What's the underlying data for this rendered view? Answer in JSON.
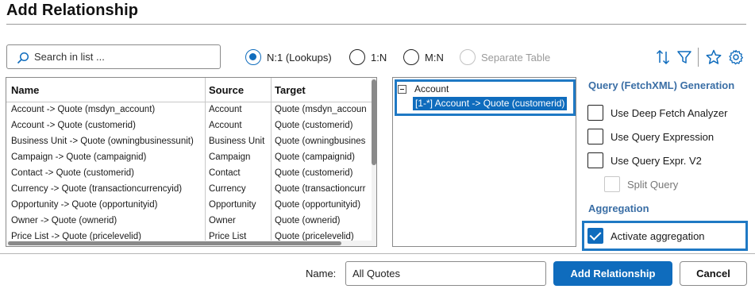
{
  "dialog": {
    "title": "Add Relationship"
  },
  "search": {
    "placeholder": "Search in list ..."
  },
  "radio_options": [
    {
      "label": "N:1 (Lookups)",
      "checked": true
    },
    {
      "label": "1:N",
      "checked": false
    },
    {
      "label": "M:N",
      "checked": false
    },
    {
      "label": "Separate Table",
      "checked": false,
      "disabled": true
    }
  ],
  "toolbar_icons": [
    "sort-icon",
    "filter-icon",
    "star-icon",
    "gear-icon"
  ],
  "table": {
    "columns": [
      "Name",
      "Source",
      "Target"
    ],
    "rows": [
      [
        "Account -> Quote (msdyn_account)",
        "Account",
        "Quote (msdyn_accoun"
      ],
      [
        "Account -> Quote (customerid)",
        "Account",
        "Quote (customerid)"
      ],
      [
        "Business Unit -> Quote (owningbusinessunit)",
        "Business Unit",
        "Quote (owningbusines"
      ],
      [
        "Campaign -> Quote (campaignid)",
        "Campaign",
        "Quote (campaignid)"
      ],
      [
        "Contact -> Quote (customerid)",
        "Contact",
        "Quote (customerid)"
      ],
      [
        "Currency -> Quote (transactioncurrencyid)",
        "Currency",
        "Quote (transactioncurr"
      ],
      [
        "Opportunity -> Quote (opportunityid)",
        "Opportunity",
        "Quote (opportunityid)"
      ],
      [
        "Owner -> Quote (ownerid)",
        "Owner",
        "Quote (ownerid)"
      ],
      [
        "Price List -> Quote (pricelevelid)",
        "Price List",
        "Quote (pricelevelid)"
      ]
    ]
  },
  "tree": {
    "root": "Account",
    "selected_child": "[1-*] Account -> Quote (customerid)"
  },
  "fetchxml": {
    "title": "Query (FetchXML) Generation",
    "options": [
      {
        "label": "Use Deep Fetch Analyzer",
        "checked": false
      },
      {
        "label": "Use Query Expression",
        "checked": false
      },
      {
        "label": "Use Query Expr. V2",
        "checked": false
      },
      {
        "label": "Split Query",
        "checked": false,
        "disabled": true
      }
    ]
  },
  "aggregation": {
    "title": "Aggregation",
    "option": {
      "label": "Activate aggregation",
      "checked": true
    }
  },
  "footer": {
    "name_label": "Name:",
    "name_value": "All Quotes",
    "primary_button": "Add Relationship",
    "cancel_button": "Cancel"
  },
  "colors": {
    "accent": "#0f6cbd",
    "section_title": "#3a6ea5",
    "highlight": "#1f79c4"
  }
}
